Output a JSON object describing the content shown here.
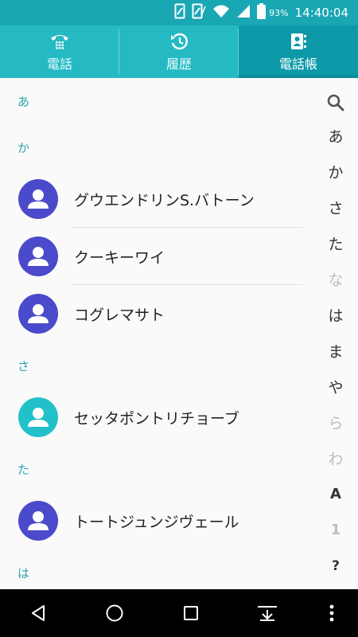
{
  "status": {
    "battery_pct": "93%",
    "time": "14:40:04",
    "icons": [
      "sim1-icon",
      "sim2-icon",
      "wifi-icon",
      "signal-icon",
      "battery-icon"
    ]
  },
  "tabs": [
    {
      "label": "電話",
      "icon": "phone-keypad-icon",
      "active": false
    },
    {
      "label": "履歴",
      "icon": "history-icon",
      "active": false
    },
    {
      "label": "電話帳",
      "icon": "contacts-book-icon",
      "active": true
    }
  ],
  "sections": [
    {
      "header": "あ",
      "contacts": []
    },
    {
      "header": "か",
      "contacts": [
        {
          "name": "グウエンドリンS.バトーン",
          "color": "#4b4acb"
        },
        {
          "name": "クーキーワイ",
          "color": "#4b4acb"
        },
        {
          "name": "コグレマサト",
          "color": "#4b4acb"
        }
      ]
    },
    {
      "header": "さ",
      "contacts": [
        {
          "name": "セッタポントリチョーブ",
          "color": "#22c1c9"
        }
      ]
    },
    {
      "header": "た",
      "contacts": [
        {
          "name": "トートジュンジヴェール",
          "color": "#4b4acb"
        }
      ]
    },
    {
      "header": "は",
      "contacts": []
    }
  ],
  "index": {
    "search_icon": "search-icon",
    "items": [
      {
        "label": "あ",
        "enabled": true
      },
      {
        "label": "か",
        "enabled": true
      },
      {
        "label": "さ",
        "enabled": true
      },
      {
        "label": "た",
        "enabled": true
      },
      {
        "label": "な",
        "enabled": false
      },
      {
        "label": "は",
        "enabled": true
      },
      {
        "label": "ま",
        "enabled": true
      },
      {
        "label": "や",
        "enabled": true
      },
      {
        "label": "ら",
        "enabled": false
      },
      {
        "label": "わ",
        "enabled": false
      },
      {
        "label": "A",
        "enabled": true
      },
      {
        "label": "1",
        "enabled": false
      },
      {
        "label": "?",
        "enabled": true
      }
    ]
  },
  "navbar": [
    "back-icon",
    "home-icon",
    "recents-icon",
    "hide-navbar-icon",
    "more-vert-icon"
  ],
  "colors": {
    "primary": "#25b9c4",
    "primary_dark": "#0d99a8",
    "section_text": "#2aa3b1"
  }
}
